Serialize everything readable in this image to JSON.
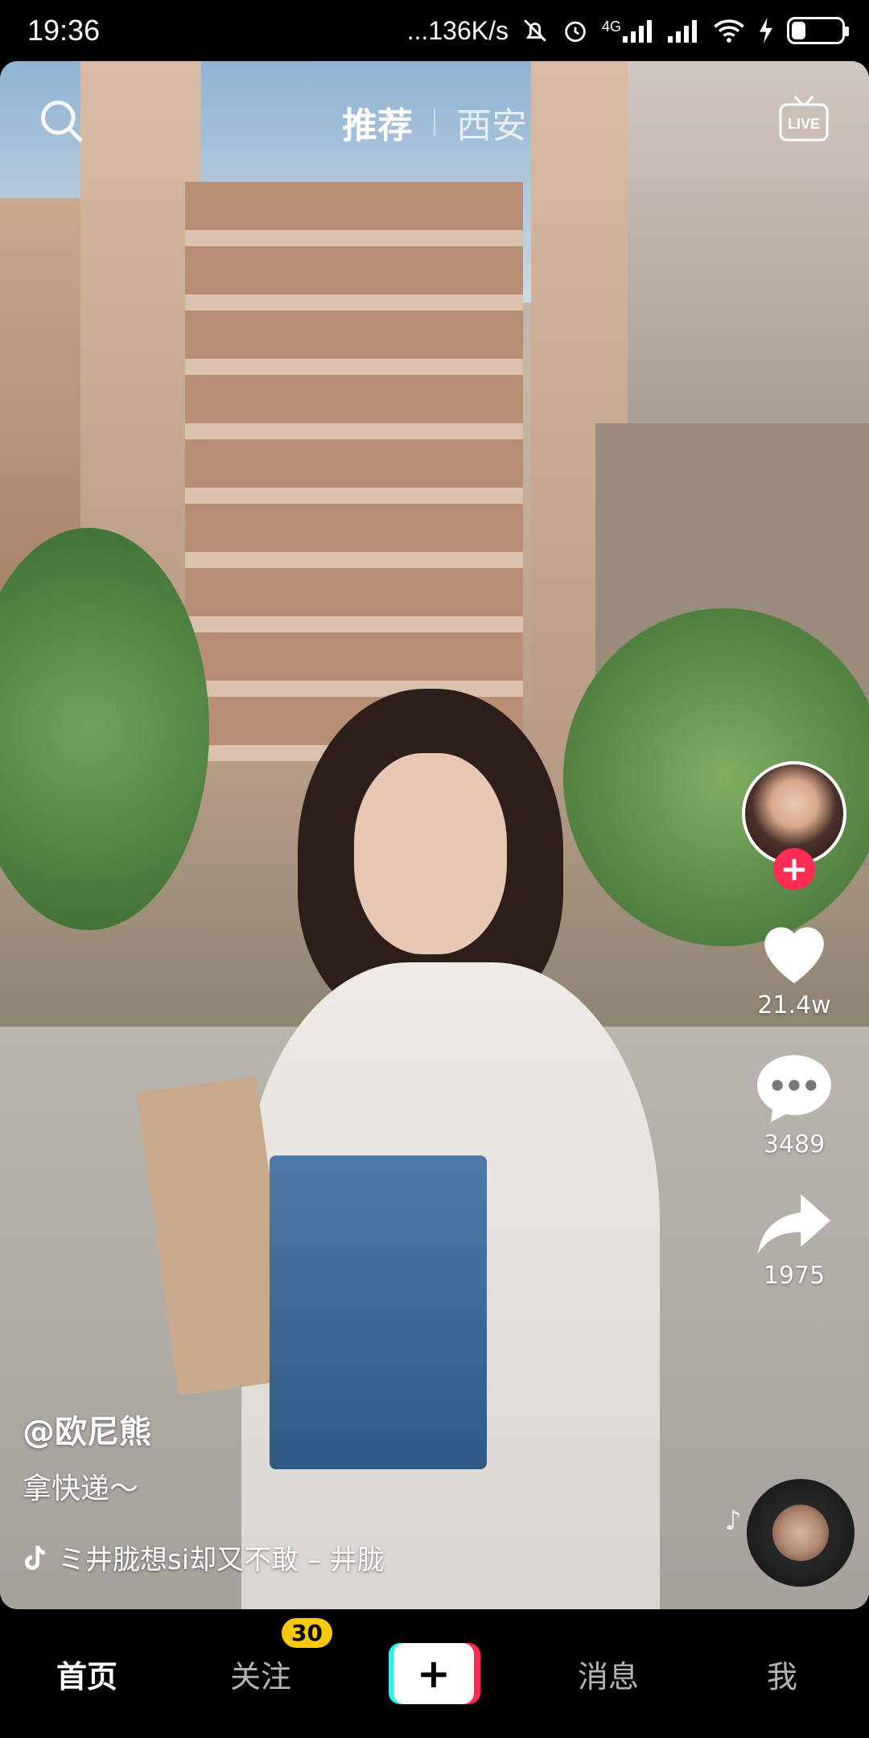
{
  "status": {
    "time": "19:36",
    "net_speed": "...136K/s",
    "signal_label": "4G",
    "battery": "25",
    "battery_fraction": 0.25
  },
  "top_nav": {
    "tab_recommend": "推荐",
    "tab_city": "西安",
    "live_label": "LIVE"
  },
  "rail": {
    "likes": "21.4w",
    "comments": "3489",
    "shares": "1975"
  },
  "caption": {
    "author": "@欧尼熊",
    "description": "拿快递～",
    "music": "ミ井胧想si却又不敢 – 井胧"
  },
  "bottom_nav": {
    "home": "首页",
    "follow": "关注",
    "follow_badge": "30",
    "add": "+",
    "messages": "消息",
    "me": "我"
  },
  "colors": {
    "accent_red": "#fe2c55",
    "accent_cyan": "#25f4ee",
    "badge_yellow": "#f8c80b"
  }
}
